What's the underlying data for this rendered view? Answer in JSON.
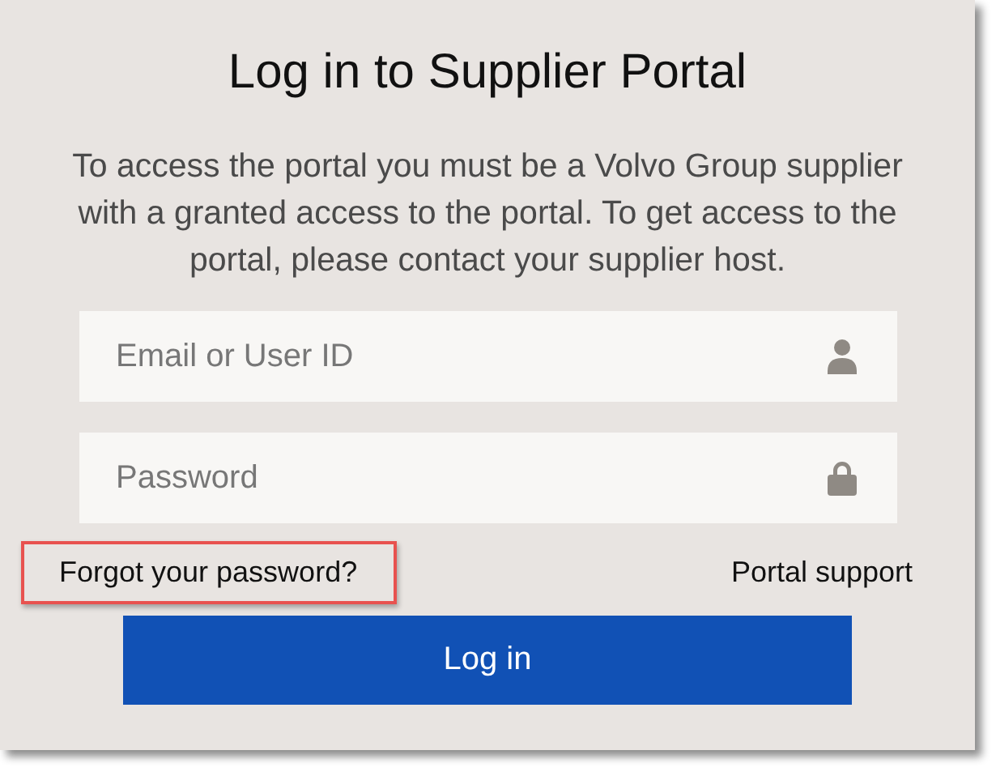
{
  "title": "Log in to Supplier Portal",
  "intro": "To access the portal you must be a Volvo Group supplier with a granted access to the portal. To get access to the portal, please contact your supplier host.",
  "fields": [
    {
      "placeholder": "Email or User ID",
      "kind": "user"
    },
    {
      "placeholder": "Password",
      "kind": "lock"
    }
  ],
  "links": [
    {
      "label": "Forgot your password?",
      "highlighted": true
    },
    {
      "label": "Portal support",
      "highlighted": false
    }
  ],
  "button": "Log in"
}
